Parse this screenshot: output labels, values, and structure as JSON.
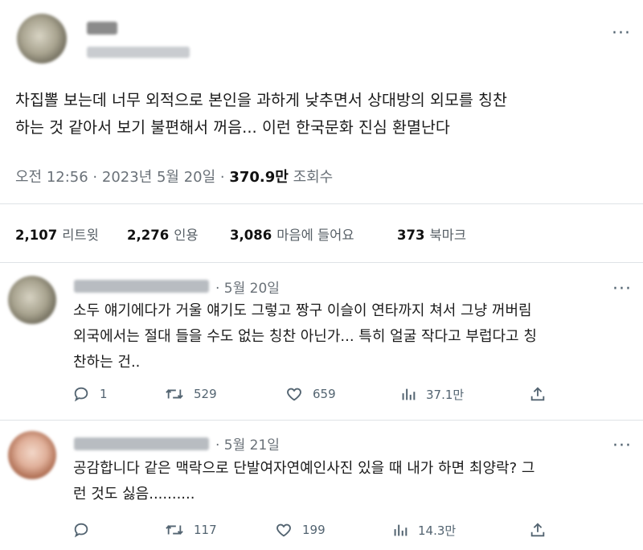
{
  "main_tweet": {
    "text_line1": "차집뽈 보는데 너무 외적으로 본인을 과하게 낮추면서 상대방의 외모를 칭찬",
    "text_line2": "하는 것 같아서 보기 불편해서 꺼음... 이런 한국문화 진심 환멸난다",
    "timestamp": "오전 12:56 · 2023년 5월 20일 · ",
    "views_count": "370.9만",
    "views_label": " 조회수",
    "stats": [
      {
        "count": "2,107",
        "label": "리트윗"
      },
      {
        "count": "2,276",
        "label": "인용"
      },
      {
        "count": "3,086",
        "label": "마음에 들어요"
      },
      {
        "count": "373",
        "label": "북마크"
      }
    ]
  },
  "replies": [
    {
      "date": "· 5월 20일",
      "lines": [
        "소두 얘기에다가 거울 얘기도 그렇고 짱구 이슬이 연타까지 쳐서 그냥 꺼버림",
        "외국에서는 절대 들을 수도 없는 칭찬 아닌가... 특히 얼굴 작다고 부럽다고 칭",
        "찬하는 건.."
      ],
      "reply_count": "1",
      "retweet_count": "529",
      "like_count": "659",
      "view_count": "37.1만"
    },
    {
      "date": "· 5월 21일",
      "lines": [
        "공감합니다 같은 맥락으로 단발여자연예인사진 있을 때 내가 하면 최양락? 그",
        "런 것도 싫음.........."
      ],
      "reply_count": "",
      "retweet_count": "117",
      "like_count": "199",
      "view_count": "14.3만"
    }
  ],
  "colors": {
    "text": "#0f1419",
    "secondary": "#536471",
    "divider": "#dfe3e6"
  },
  "icons": [
    "more-icon",
    "reply-icon",
    "retweet-icon",
    "like-icon",
    "views-icon",
    "share-icon"
  ]
}
